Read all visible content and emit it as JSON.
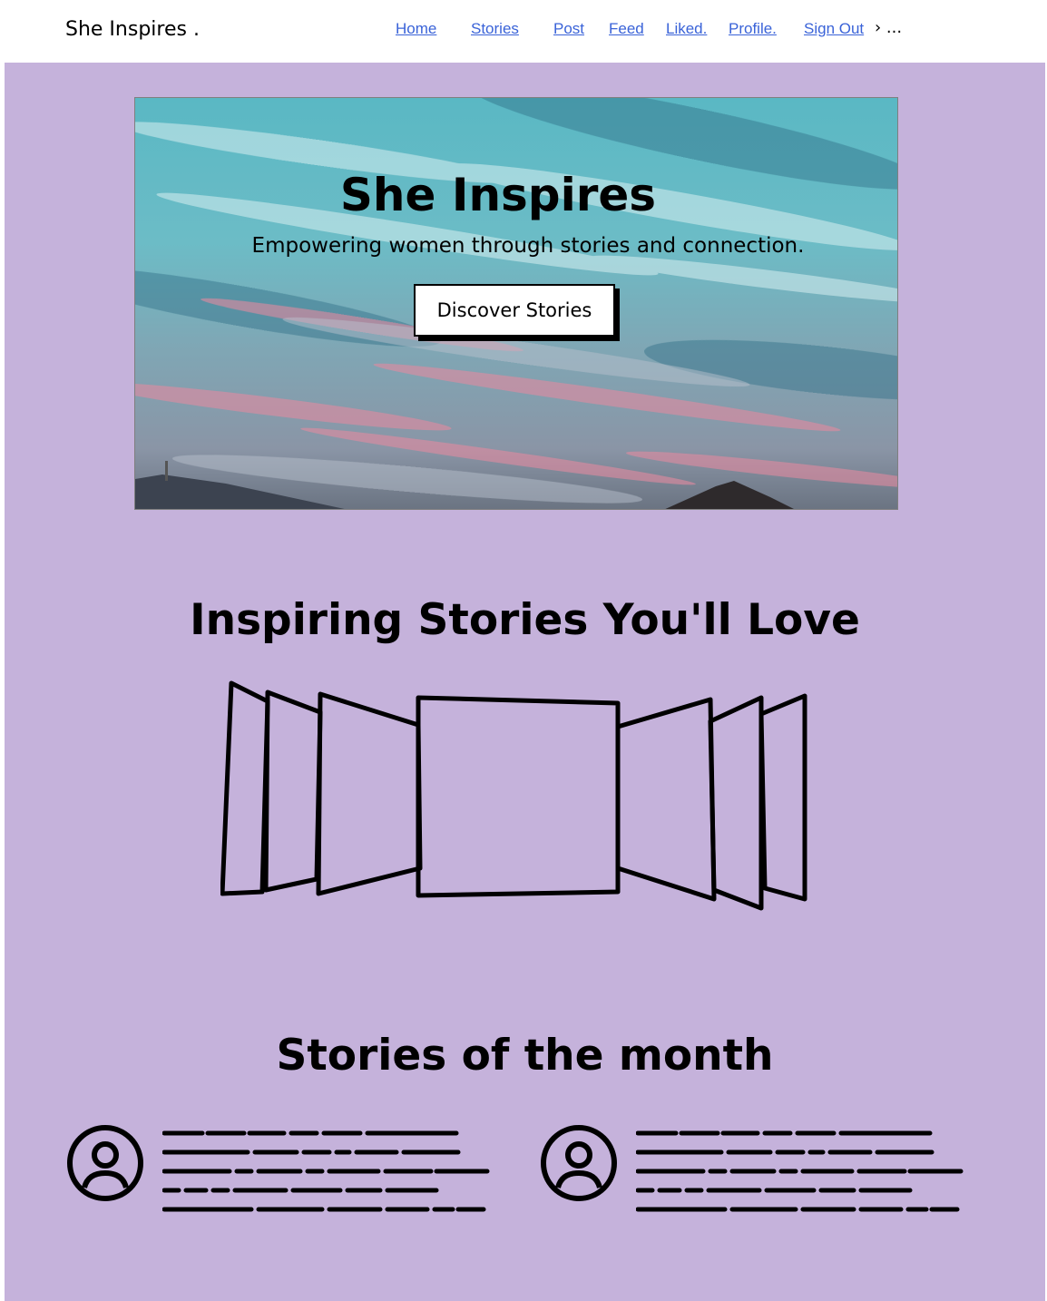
{
  "header": {
    "brand": "She Inspires .",
    "nav": [
      "Home",
      "Stories",
      "Post",
      "Feed",
      "Liked.",
      "Profile.",
      "Sign Out"
    ],
    "more": "› ..."
  },
  "hero": {
    "title": "She Inspires",
    "subtitle": "Empowering women through stories and connection.",
    "button": "Discover Stories"
  },
  "sections": {
    "inspiring_title": "Inspiring Stories You'll Love",
    "month_title": "Stories of the month"
  },
  "colors": {
    "page_bg": "#c5b2db",
    "link": "#3a63d8"
  },
  "icons": {
    "carousel": "carousel-placeholder-icon",
    "avatar": "user-avatar-icon"
  }
}
